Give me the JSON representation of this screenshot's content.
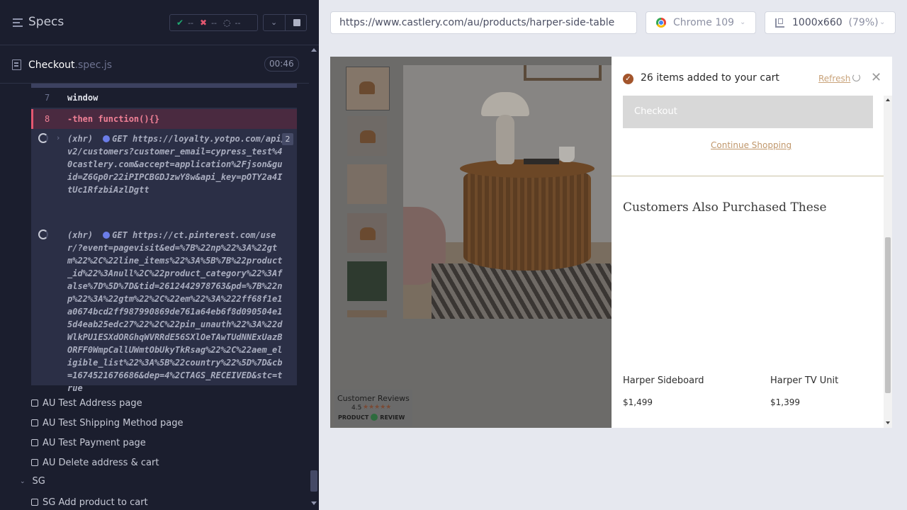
{
  "runner": {
    "title": "Specs",
    "stats": {
      "passed": "--",
      "failed": "--",
      "pending": "--"
    },
    "spec": {
      "name": "Checkout",
      "ext": ".spec.js",
      "duration": "00:46"
    },
    "commands": [
      {
        "num": "7",
        "text": "window"
      },
      {
        "num": "8",
        "text": "-then  function(){}"
      }
    ],
    "xhr": [
      {
        "label": "(xhr)",
        "method": "GET",
        "url": "https://loyalty.yotpo.com/api/v2/customers?customer_email=cypress_test%40castlery.com&accept=application%2Fjson&guid=Z6Gp0r22iPIPCBGDJzwY8w&api_key=pOTY2a4ItUc1RfzbiAzlDgtt",
        "count": "2"
      },
      {
        "label": "(xhr)",
        "method": "GET",
        "url": "https://ct.pinterest.com/user/?event=pagevisit&ed=%7B%22np%22%3A%22gtm%22%2C%22line_items%22%3A%5B%7B%22product_id%22%3Anull%2C%22product_category%22%3Afalse%7D%5D%7D&tid=2612442978763&pd=%7B%22np%22%3A%22gtm%22%2C%22em%22%3A%222ff68f1e1a0674bcd2ff987990869de761a64eb6f8d090504e15d4eab25edc27%22%2C%22pin_unauth%22%3A%22dWlkPU1ESXdORGhqWVRRdE56SXlOeTAwTUdNNExUazBORFF0WmpCallUWmtObUkyTkRsag%22%2C%22aem_eligible_list%22%3A%5B%22country%22%5D%7D&cb=1674521676686&dep=4%2CTAGS_RECEIVED&stc=true",
        "count": ""
      }
    ],
    "tests": [
      "AU Test Address page",
      "AU Test Shipping Method page",
      "AU Test Payment page",
      "AU Delete address & cart"
    ],
    "suite": "SG",
    "suite_tests": [
      "SG Add product to cart"
    ]
  },
  "aut": {
    "url": "https://www.castlery.com/au/products/harper-side-table",
    "browser": "Chrome 109",
    "viewport": "1000x660",
    "zoom": "(79%)"
  },
  "page": {
    "reviews": {
      "title": "Customer Reviews",
      "rating": "4.5",
      "stars": "★★★★★",
      "brand_left": "PRODUCT",
      "brand_right": "REVIEW"
    }
  },
  "cart": {
    "added_text": "26 items added to your cart",
    "refresh": "Refresh",
    "checkout": "Checkout",
    "continue": "Continue Shopping",
    "also_heading": "Customers Also Purchased These",
    "products": [
      {
        "name": "Harper Sideboard",
        "price": "$1,499"
      },
      {
        "name": "Harper TV Unit",
        "price": "$1,399"
      }
    ]
  },
  "colors": {
    "runner_bg": "#1b1e2e",
    "fail": "#e45770",
    "pass": "#1fa971",
    "brand_accent": "#a3552c"
  }
}
